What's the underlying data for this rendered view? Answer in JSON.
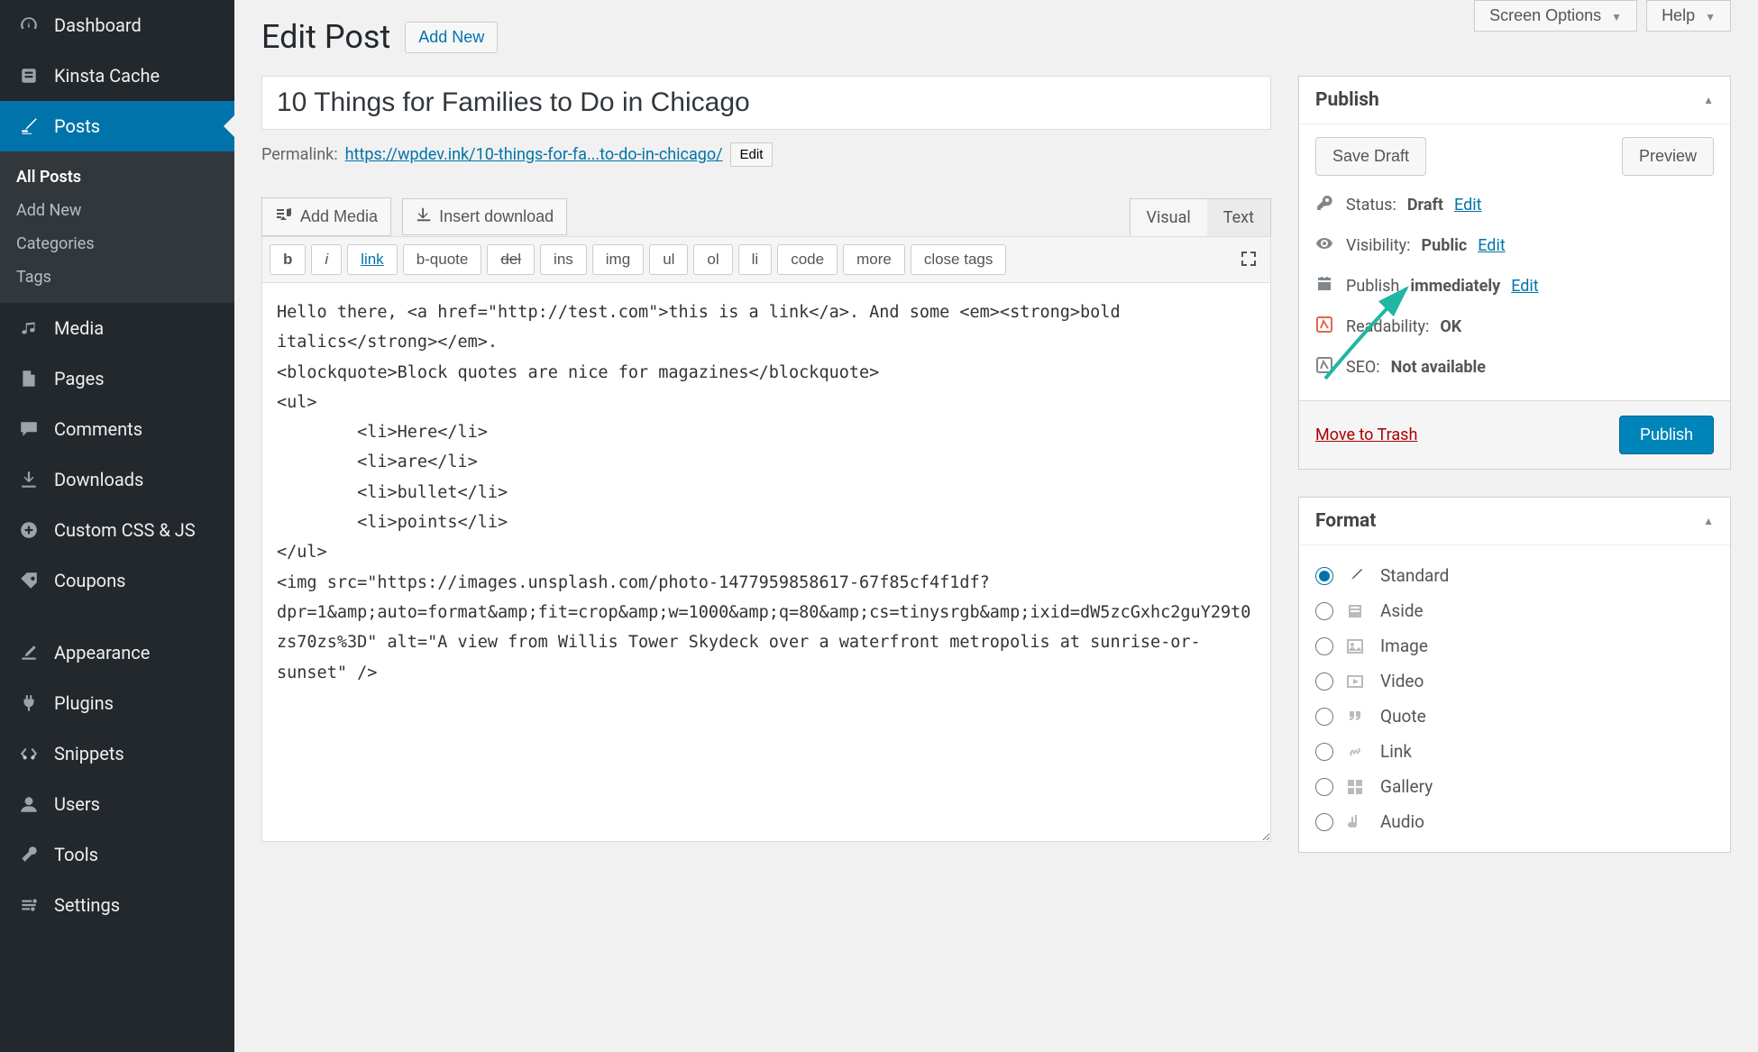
{
  "screen_options_label": "Screen Options",
  "help_label": "Help",
  "page_title": "Edit Post",
  "add_new_label": "Add New",
  "sidebar": [
    {
      "k": "dashboard",
      "label": "Dashboard"
    },
    {
      "k": "kinsta",
      "label": "Kinsta Cache"
    },
    {
      "k": "posts",
      "label": "Posts",
      "active": true,
      "subs": [
        {
          "label": "All Posts",
          "current": true
        },
        {
          "label": "Add New"
        },
        {
          "label": "Categories"
        },
        {
          "label": "Tags"
        }
      ]
    },
    {
      "k": "media",
      "label": "Media"
    },
    {
      "k": "pages",
      "label": "Pages"
    },
    {
      "k": "comments",
      "label": "Comments"
    },
    {
      "k": "downloads",
      "label": "Downloads"
    },
    {
      "k": "customcss",
      "label": "Custom CSS & JS"
    },
    {
      "k": "coupons",
      "label": "Coupons"
    },
    {
      "k": "appearance",
      "label": "Appearance"
    },
    {
      "k": "plugins",
      "label": "Plugins"
    },
    {
      "k": "snippets",
      "label": "Snippets"
    },
    {
      "k": "users",
      "label": "Users"
    },
    {
      "k": "tools",
      "label": "Tools"
    },
    {
      "k": "settings",
      "label": "Settings"
    }
  ],
  "post_title": "10 Things for Families to Do in Chicago",
  "permalink_label": "Permalink:",
  "permalink_base": "https://wpdev.ink/",
  "permalink_slug": "10-things-for-fa...to-do-in-chicago/",
  "edit_label": "Edit",
  "add_media_label": "Add Media",
  "insert_download_label": "Insert download",
  "tab_visual": "Visual",
  "tab_text": "Text",
  "quicktags": [
    "b",
    "i",
    "link",
    "b-quote",
    "del",
    "ins",
    "img",
    "ul",
    "ol",
    "li",
    "code",
    "more",
    "close tags"
  ],
  "editor_content": "Hello there, <a href=\"http://test.com\">this is a link</a>. And some <em><strong>bold italics</strong></em>.\n<blockquote>Block quotes are nice for magazines</blockquote>\n<ul>\n \t<li>Here</li>\n \t<li>are</li>\n \t<li>bullet</li>\n \t<li>points</li>\n</ul>\n<img src=\"https://images.unsplash.com/photo-1477959858617-67f85cf4f1df?dpr=1&amp;auto=format&amp;fit=crop&amp;w=1000&amp;q=80&amp;cs=tinysrgb&amp;ixid=dW5zcGxhc2guY29t0zs70zs%3D\" alt=\"A view from Willis Tower Skydeck over a waterfront metropolis at sunrise-or-sunset\" />",
  "publish": {
    "title": "Publish",
    "save_draft": "Save Draft",
    "preview": "Preview",
    "status_label": "Status:",
    "status_value": "Draft",
    "visibility_label": "Visibility:",
    "visibility_value": "Public",
    "schedule_label": "Publish",
    "schedule_value": "immediately",
    "readability_label": "Readability:",
    "readability_value": "OK",
    "seo_label": "SEO:",
    "seo_value": "Not available",
    "trash": "Move to Trash",
    "publish": "Publish"
  },
  "format": {
    "title": "Format",
    "options": [
      "Standard",
      "Aside",
      "Image",
      "Video",
      "Quote",
      "Link",
      "Gallery",
      "Audio"
    ],
    "selected": "Standard"
  }
}
